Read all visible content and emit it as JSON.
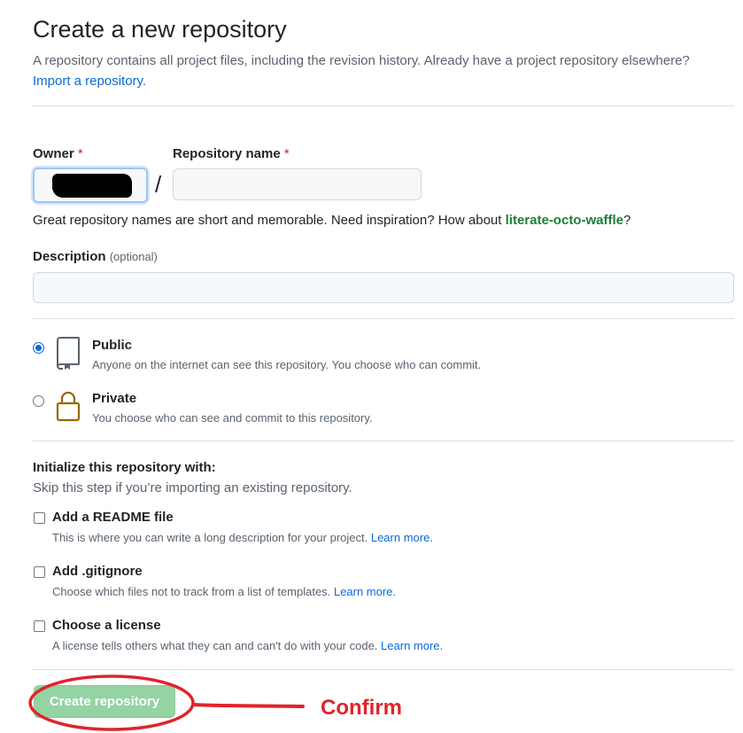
{
  "header": {
    "title": "Create a new repository",
    "description": "A repository contains all project files, including the revision history. Already have a project repository elsewhere?",
    "import_link": "Import a repository."
  },
  "owner": {
    "label": "Owner",
    "required_mark": "*"
  },
  "repo_name": {
    "label": "Repository name",
    "required_mark": "*",
    "value": "",
    "separator": "/"
  },
  "name_hint": {
    "text": "Great repository names are short and memorable. Need inspiration? How about",
    "suggestion": "literate-octo-waffle",
    "suffix": "?"
  },
  "description_field": {
    "label": "Description",
    "optional": "(optional)",
    "value": ""
  },
  "visibility": [
    {
      "title": "Public",
      "desc": "Anyone on the internet can see this repository. You choose who can commit.",
      "selected": true,
      "icon": "repo-icon"
    },
    {
      "title": "Private",
      "desc": "You choose who can see and commit to this repository.",
      "selected": false,
      "icon": "lock-icon"
    }
  ],
  "init": {
    "heading": "Initialize this repository with:",
    "subheading": "Skip this step if you’re importing an existing repository.",
    "options": [
      {
        "title": "Add a README file",
        "desc": "This is where you can write a long description for your project.",
        "link": "Learn more."
      },
      {
        "title": "Add .gitignore",
        "desc": "Choose which files not to track from a list of templates.",
        "link": "Learn more."
      },
      {
        "title": "Choose a license",
        "desc": "A license tells others what they can and can't do with your code.",
        "link": "Learn more."
      }
    ]
  },
  "actions": {
    "create_label": "Create repository"
  },
  "annotation": {
    "text": "Confirm",
    "color": "#e0242b"
  },
  "colors": {
    "link": "#0969da",
    "suggest": "#1a7f37",
    "required": "#cf222e",
    "create_button": "#94d3a2"
  }
}
